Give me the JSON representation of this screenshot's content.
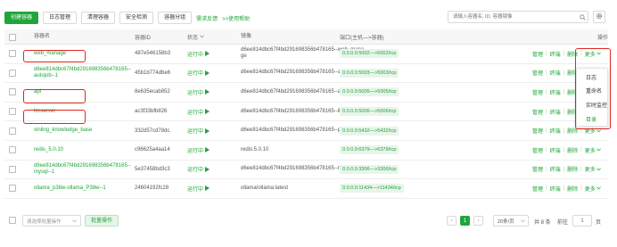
{
  "toolbar": {
    "create_label": "创建容器",
    "logs_label": "日志管理",
    "clean_label": "清理容器",
    "security_label": "安全检测",
    "groups_label": "容器分组",
    "feedback_label": "需求反馈",
    "help_label": ">>使用帮助"
  },
  "search": {
    "placeholder": "请输入容器名, ID, 容器镜像"
  },
  "table": {
    "headers": {
      "name": "容器名",
      "id": "容器ID",
      "status": "状态",
      "image": "镜像",
      "port": "端口(主机—>容器)",
      "action": "操作"
    },
    "rows": [
      {
        "name": "web_manage",
        "id": "487e546158b3",
        "status": "运行中",
        "image": "d6ee814dbc67f4bd291698356b478165--web_manage",
        "port": "0.0.0.0:5002—>5002/tcp",
        "highlight": true
      },
      {
        "name": "d6ee814dbc67f4bd291698356b478165--autojob--1",
        "id": "45b1b774dbe6",
        "status": "运行中",
        "image": "d6ee814dbc67f4bd291698356b478165--autojob",
        "port": "0.0.0.0:5003—>5003/tcp",
        "highlight": false
      },
      {
        "name": "api",
        "id": "8e635ecab852",
        "status": "运行中",
        "image": "d6ee814dbc67f4bd291698356b478165--api",
        "port": "0.0.0.0:5005—>5005/tcp",
        "highlight": true
      },
      {
        "name": "llmserver",
        "id": "ac3f33bfb826",
        "status": "运行中",
        "image": "d6ee814dbc67f4bd291698356b478165--llmserver",
        "port": "0.0.0.0:5006—>5006/tcp",
        "highlight": true
      },
      {
        "name": "xinling_knowledge_base",
        "id": "332d57cd78dc",
        "status": "运行中",
        "image": "d6ee814dbc67f4bd291698356b478165--postgres",
        "port": "0.0.0.0:5432—>5432/tcp",
        "highlight": false
      },
      {
        "name": "redis_5.0.10",
        "id": "c96625a4aa14",
        "status": "运行中",
        "image": "redis:5.0.10",
        "port": "0.0.0.0:6379—>6379/tcp",
        "highlight": false
      },
      {
        "name": "d6ee814dbc67f4bd291698356b478165--mysql--1",
        "id": "5e37458bd3c3",
        "status": "运行中",
        "image": "d6ee814dbc67f4bd291698356b478165--mysql",
        "port": "0.0.0.0:3306—>3306/tcp",
        "highlight": false
      },
      {
        "name": "ollama_p38w-ollama_P38w--1",
        "id": "24604192fc28",
        "status": "运行中",
        "image": "ollama/ollama:latest",
        "port": "0.0.0.0:11434—>11434/tcp",
        "highlight": false
      }
    ],
    "actions": {
      "manage": "管理",
      "terminal": "终端",
      "delete": "删除",
      "more": "更多"
    }
  },
  "dropdown": {
    "items": [
      "日志",
      "重命名",
      "实时监控",
      "目录"
    ],
    "highlighted_item": "目录"
  },
  "footer": {
    "batch_placeholder": "请选择批量操作",
    "batch_button": "批量操作",
    "current_page": "1",
    "page_size": "20条/页",
    "total": "共 8 条",
    "goto_label": "前往",
    "goto_value": "1",
    "page_unit": "页"
  },
  "colors": {
    "accent": "#20a53a",
    "highlight_border": "#e0281e"
  }
}
